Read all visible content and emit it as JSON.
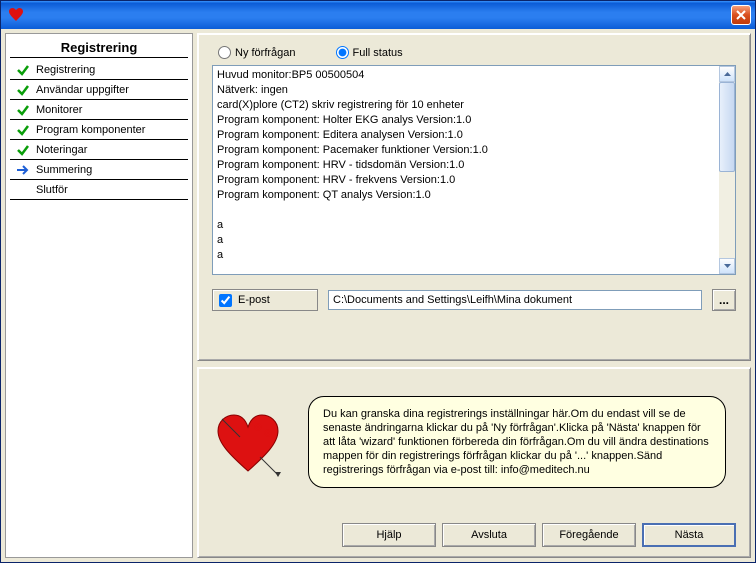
{
  "sidebar": {
    "title": "Registrering",
    "steps": [
      {
        "label": "Registrering",
        "state": "done"
      },
      {
        "label": "Användar uppgifter",
        "state": "done"
      },
      {
        "label": "Monitorer",
        "state": "done"
      },
      {
        "label": "Program komponenter",
        "state": "done"
      },
      {
        "label": "Noteringar",
        "state": "done"
      },
      {
        "label": "Summering",
        "state": "current"
      },
      {
        "label": "Slutför",
        "state": "pending"
      }
    ]
  },
  "top_panel": {
    "radio_new": "Ny förfrågan",
    "radio_full": "Full status",
    "radio_selected": "full",
    "status_text": "Huvud monitor:BP5 00500504\nNätverk: ingen\ncard(X)plore (CT2) skriv registrering för 10 enheter\nProgram komponent: Holter EKG analys Version:1.0\nProgram komponent: Editera analysen Version:1.0\nProgram komponent: Pacemaker funktioner Version:1.0\nProgram komponent: HRV - tidsdomän Version:1.0\nProgram komponent: HRV - frekvens Version:1.0\nProgram komponent: QT analys Version:1.0\n\na\na\na",
    "email_label": "E-post",
    "email_checked": true,
    "path_value": "C:\\Documents and Settings\\Leifh\\Mina dokument",
    "browse_label": "..."
  },
  "bottom_panel": {
    "help_text": "Du kan granska dina registrerings inställningar här.Om du endast vill se de senaste ändringarna klickar du på 'Ny förfrågan'.Klicka på 'Nästa' knappen för att låta 'wizard' funktionen förbereda din förfrågan.Om du vill ändra destinations mappen för din registrerings förfrågan klickar du på '...' knappen.Sänd registrerings förfrågan via e-post till:  info@meditech.nu",
    "buttons": {
      "help": "Hjälp",
      "cancel": "Avsluta",
      "back": "Föregående",
      "next": "Nästa"
    }
  }
}
